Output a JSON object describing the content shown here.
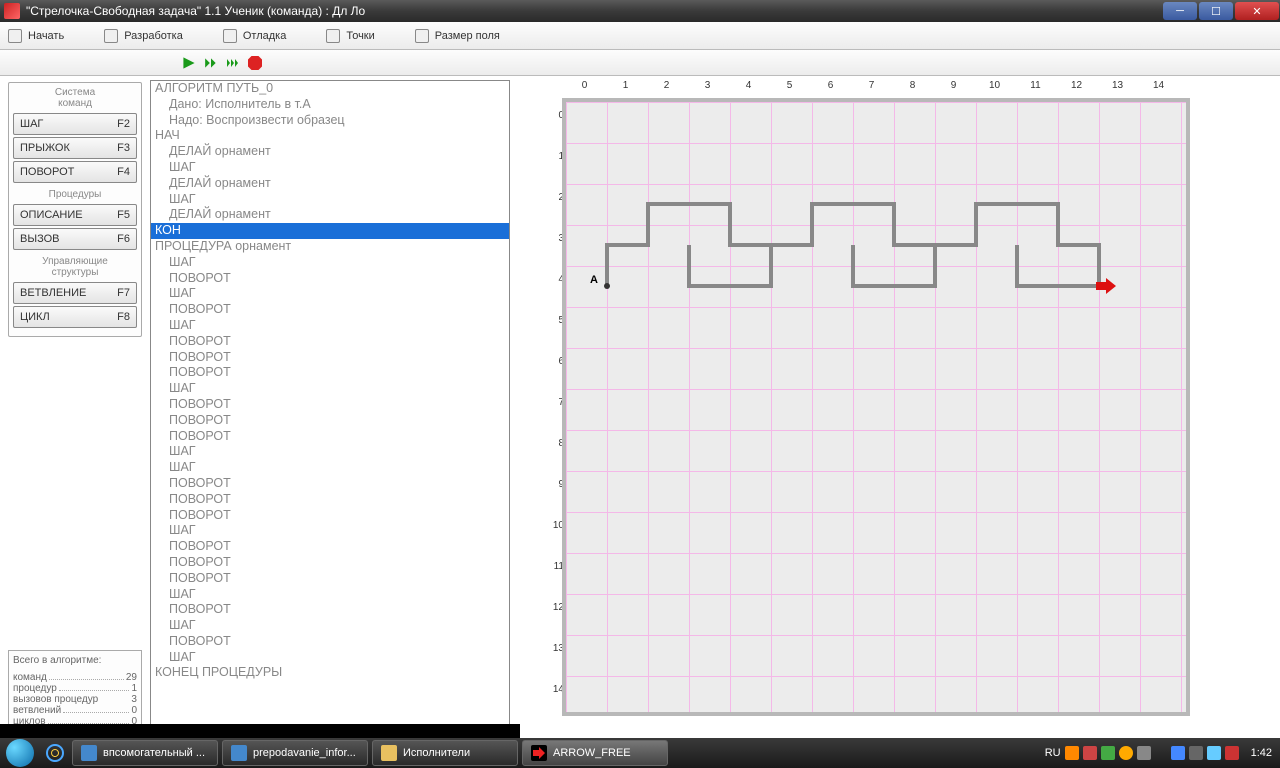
{
  "window": {
    "title": "\"Стрелочка-Свободная задача\" 1.1    Ученик (команда) : Дл Ло"
  },
  "menu": {
    "start": "Начать",
    "develop": "Разработка",
    "debug": "Отладка",
    "points": "Точки",
    "fieldsize": "Размер поля"
  },
  "panels": {
    "system_title": "Система\nкоманд",
    "step": "ШАГ",
    "step_key": "F2",
    "jump": "ПРЫЖОК",
    "jump_key": "F3",
    "turn": "ПОВОРОТ",
    "turn_key": "F4",
    "procs_title": "Процедуры",
    "desc": "ОПИСАНИЕ",
    "desc_key": "F5",
    "call": "ВЫЗОВ",
    "call_key": "F6",
    "ctrl_title": "Управляющие\nструктуры",
    "branch": "ВЕТВЛЕНИЕ",
    "branch_key": "F7",
    "loop": "ЦИКЛ",
    "loop_key": "F8"
  },
  "stats": {
    "title": "Всего в алгоритме:",
    "commands_label": "команд",
    "commands": "29",
    "procs_label": "процедур",
    "procs": "1",
    "calls_label": "вызовов процедур",
    "calls": "3",
    "branches_label": "ветвлений",
    "branches": "0",
    "loops_label": "циклов",
    "loops": "0"
  },
  "code": [
    {
      "t": "АЛГОРИТМ ПУТЬ_0",
      "i": 0
    },
    {
      "t": "Дано: Исполнитель в т.A",
      "i": 1
    },
    {
      "t": "Надо: Воспроизвести образец",
      "i": 1
    },
    {
      "t": "НАЧ",
      "i": 0
    },
    {
      "t": "ДЕЛАЙ орнамент",
      "i": 1
    },
    {
      "t": "ШАГ",
      "i": 1
    },
    {
      "t": "ДЕЛАЙ орнамент",
      "i": 1
    },
    {
      "t": "ШАГ",
      "i": 1
    },
    {
      "t": "ДЕЛАЙ орнамент",
      "i": 1
    },
    {
      "t": "КОН",
      "i": 0,
      "sel": true
    },
    {
      "t": "ПРОЦЕДУРА орнамент",
      "i": 0
    },
    {
      "t": "ШАГ",
      "i": 1
    },
    {
      "t": "ПОВОРОТ",
      "i": 1
    },
    {
      "t": "ШАГ",
      "i": 1
    },
    {
      "t": "ПОВОРОТ",
      "i": 1
    },
    {
      "t": "ШАГ",
      "i": 1
    },
    {
      "t": "ПОВОРОТ",
      "i": 1
    },
    {
      "t": "ПОВОРОТ",
      "i": 1
    },
    {
      "t": "ПОВОРОТ",
      "i": 1
    },
    {
      "t": "ШАГ",
      "i": 1
    },
    {
      "t": "ПОВОРОТ",
      "i": 1
    },
    {
      "t": "ПОВОРОТ",
      "i": 1
    },
    {
      "t": "ПОВОРОТ",
      "i": 1
    },
    {
      "t": "ШАГ",
      "i": 1
    },
    {
      "t": "ШАГ",
      "i": 1
    },
    {
      "t": "ПОВОРОТ",
      "i": 1
    },
    {
      "t": "ПОВОРОТ",
      "i": 1
    },
    {
      "t": "ПОВОРОТ",
      "i": 1
    },
    {
      "t": "ШАГ",
      "i": 1
    },
    {
      "t": "ПОВОРОТ",
      "i": 1
    },
    {
      "t": "ПОВОРОТ",
      "i": 1
    },
    {
      "t": "ПОВОРОТ",
      "i": 1
    },
    {
      "t": "ШАГ",
      "i": 1
    },
    {
      "t": "ПОВОРОТ",
      "i": 1
    },
    {
      "t": "ШАГ",
      "i": 1
    },
    {
      "t": "ПОВОРОТ",
      "i": 1
    },
    {
      "t": "ШАГ",
      "i": 1
    },
    {
      "t": "КОНЕЦ ПРОЦЕДУРЫ",
      "i": 0
    }
  ],
  "grid": {
    "cols": 15,
    "rows": 15,
    "origin_label": "A"
  },
  "taskbar": {
    "items": [
      {
        "label": "впсомогательный ...",
        "active": false
      },
      {
        "label": "prepodavanie_infor...",
        "active": false
      },
      {
        "label": "Исполнители",
        "active": false
      },
      {
        "label": "ARROW_FREE",
        "active": true
      }
    ],
    "lang": "RU",
    "clock": "1:42"
  }
}
